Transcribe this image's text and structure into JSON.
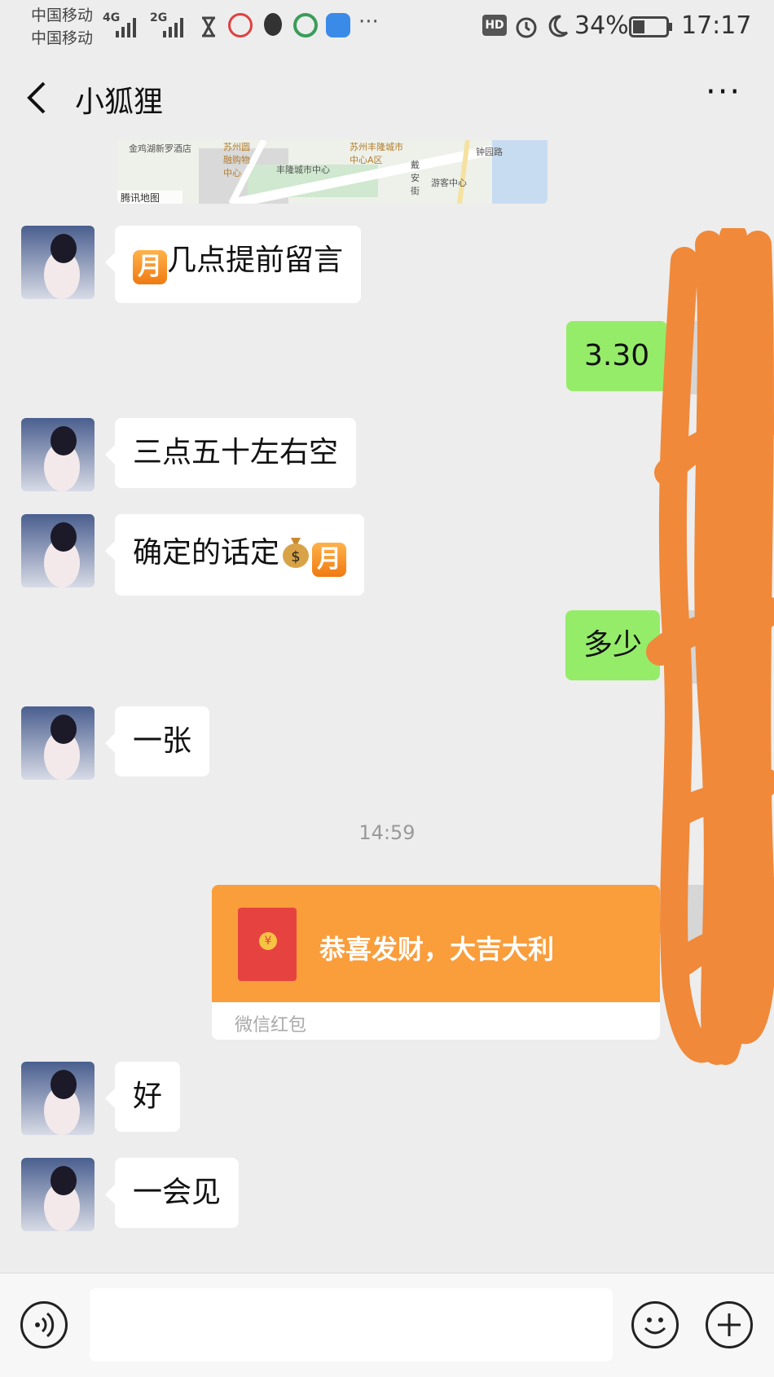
{
  "status_bar": {
    "carrier1": "中国移动",
    "carrier2": "中国移动",
    "net1": "4G",
    "net2": "2G",
    "hd": "HD",
    "battery": "34%",
    "time": "17:17"
  },
  "header": {
    "title": "小狐狸"
  },
  "map": {
    "labels": [
      "金鸡湖新罗酒店",
      "苏州圆融购物中心",
      "苏州丰隆城市中心A区",
      "丰隆城市中心",
      "钟园路",
      "游客中心",
      "戴安街",
      "腾讯地图"
    ]
  },
  "messages": [
    {
      "side": "left",
      "text": "几点提前留言",
      "prefix_emoji": "月"
    },
    {
      "side": "right",
      "text": "3.30"
    },
    {
      "side": "left",
      "text": "三点五十左右空"
    },
    {
      "side": "left",
      "text": "确定的话定",
      "suffix_emoji": "月"
    },
    {
      "side": "right",
      "text": "多少"
    },
    {
      "side": "left",
      "text": "一张"
    },
    {
      "side": "left",
      "text": "好"
    },
    {
      "side": "left",
      "text": "一会见"
    }
  ],
  "timestamp": "14:59",
  "red_packet": {
    "title": "恭喜发财，大吉大利",
    "footer": "微信红包",
    "coin": "¥"
  },
  "colors": {
    "background": "#ededed",
    "sent_bubble": "#95ec69",
    "received_bubble": "#ffffff",
    "red_packet": "#fa9d3b",
    "scribble": "#f0893a"
  },
  "icons": [
    "back-arrow-icon",
    "more-icon",
    "voice-icon",
    "emoji-icon",
    "plus-icon"
  ]
}
